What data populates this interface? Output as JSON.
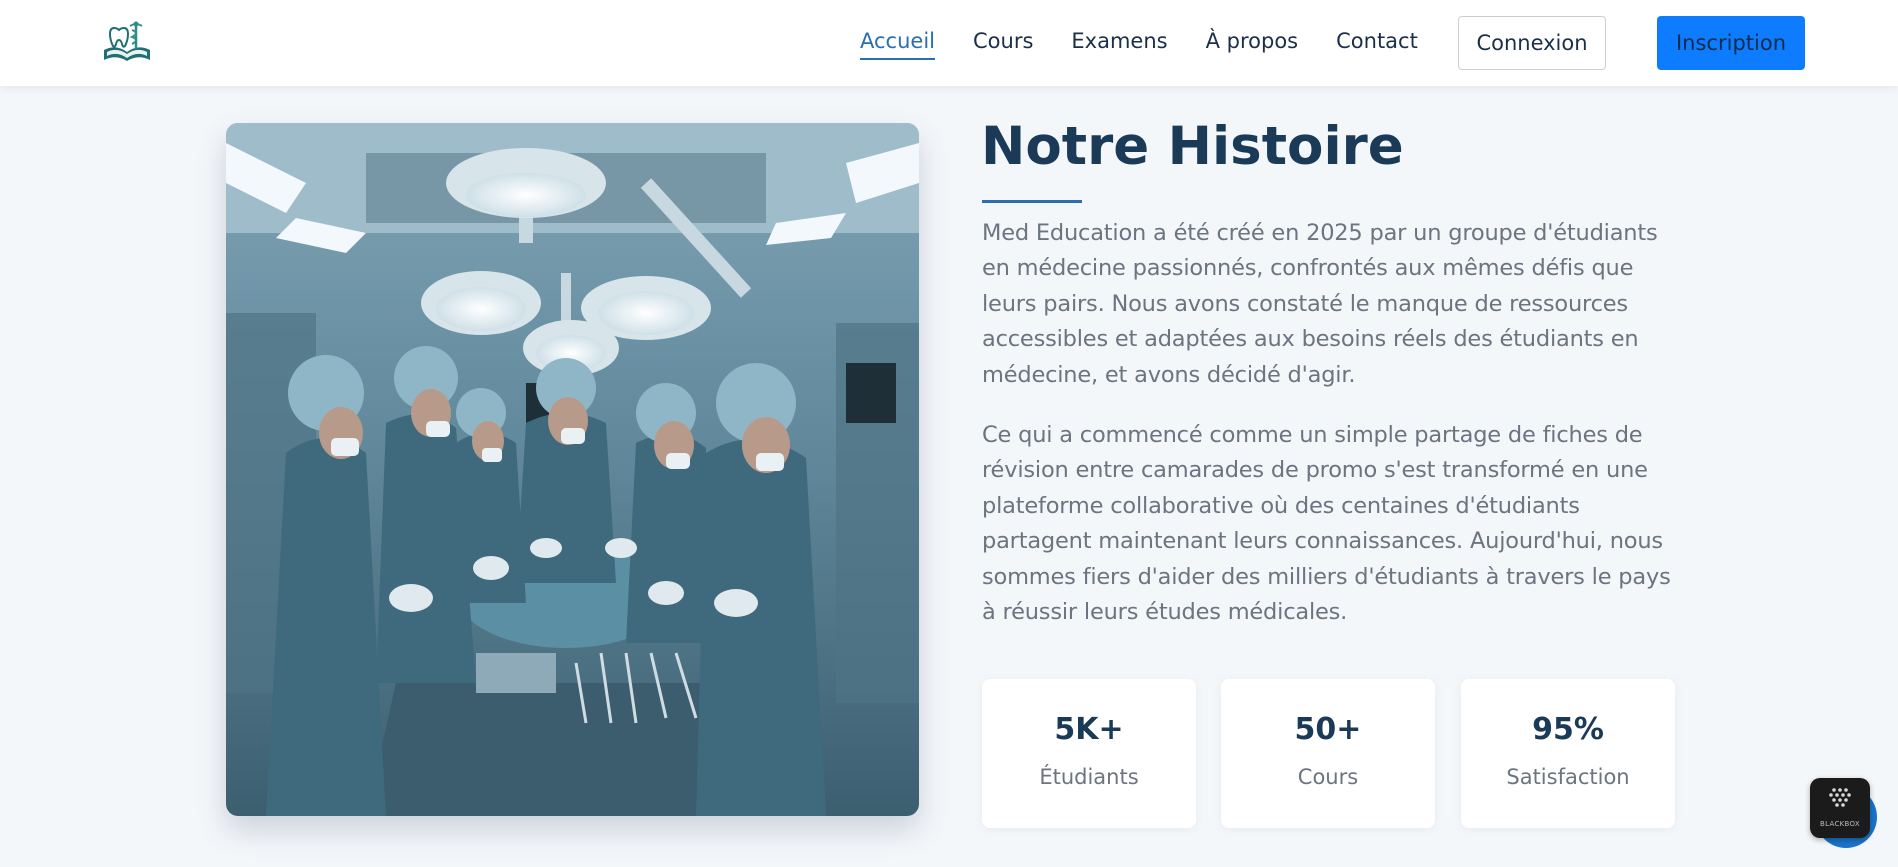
{
  "nav": {
    "links": [
      {
        "label": "Accueil",
        "active": true
      },
      {
        "label": "Cours",
        "active": false
      },
      {
        "label": "Examens",
        "active": false
      },
      {
        "label": "À propos",
        "active": false
      },
      {
        "label": "Contact",
        "active": false
      }
    ],
    "login_label": "Connexion",
    "signup_label": "Inscription"
  },
  "story": {
    "title": "Notre Histoire",
    "paragraph1": "Med Education a été créé en 2025 par un groupe d'étudiants en médecine passionnés, confrontés aux mêmes défis que leurs pairs. Nous avons constaté le manque de ressources accessibles et adaptées aux besoins réels des étudiants en médecine, et avons décidé d'agir.",
    "paragraph2": "Ce qui a commencé comme un simple partage de fiches de révision entre camarades de promo s'est transformé en une plateforme collaborative où des centaines d'étudiants partagent maintenant leurs connaissances. Aujourd'hui, nous sommes fiers d'aider des milliers d'étudiants à travers le pays à réussir leurs études médicales."
  },
  "stats": [
    {
      "value": "5K+",
      "label": "Étudiants"
    },
    {
      "value": "50+",
      "label": "Cours"
    },
    {
      "value": "95%",
      "label": "Satisfaction"
    }
  ],
  "widget": {
    "badge_text": "BLACKBOX"
  },
  "colors": {
    "accent": "#2a6fb0",
    "primary_button": "#0d7cff",
    "heading": "#1b3a57",
    "body_text": "#6b7480",
    "background": "#f4f7fa"
  },
  "icons": {
    "logo": "med-education-logo-icon",
    "photo": "operating-room-photo"
  }
}
